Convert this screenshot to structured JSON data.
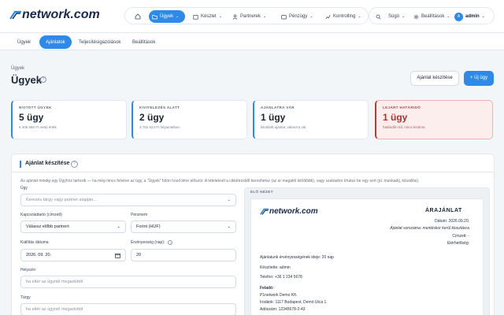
{
  "brand": {
    "logo": "network.com"
  },
  "nav": {
    "home_icon": "home-icon",
    "items": [
      {
        "label": "Ügyek"
      },
      {
        "label": "Készlet"
      },
      {
        "label": "Partnerek"
      },
      {
        "label": "Pénzügy"
      },
      {
        "label": "Kontrolling"
      }
    ],
    "search_icon": "search-icon",
    "help": "Súgó",
    "settings": "Beállítások",
    "avatar": "A",
    "user": "admin"
  },
  "subtabs": [
    {
      "label": "Ügyek"
    },
    {
      "label": "Ajánlatok"
    },
    {
      "label": "Teljesítésigazolások"
    },
    {
      "label": "Beállítások"
    }
  ],
  "page": {
    "breadcrumb": "Ügyek",
    "title": "Ügyek",
    "help": "?",
    "btn_quote": "Ajánlat készítése",
    "btn_new": "+ Új ügy"
  },
  "cards": [
    {
      "label": "NYITOTT ÜGYEK",
      "value": "5 ügy",
      "sub": "6 406 560 Ft nettó érték"
    },
    {
      "label": "KIVITELEZÉS ALATT",
      "value": "2 ügy",
      "sub": "3 752 624 Ft folyamatban"
    },
    {
      "label": "AJÁNLATRA VÁR",
      "value": "1 ügy",
      "sub": "kiküldött ajánlat, válaszra vár"
    },
    {
      "label": "LEJÁRT HATÁRIDŐ",
      "value": "1 ügy",
      "sub": "határidőn túl, nincs lezárva"
    }
  ],
  "form": {
    "title": "Ajánlat készítése",
    "help": "?",
    "intro": "Az ajánlat mindig egy Ügyhöz tartozik — ha még nincs felvéve az ügy, a \"Ügyek\" fülön hozd létre először. A tételeknél a cikktörzsből kereshetsz (az ár magától kitöltődik), vagy szabadon írhatsz be egy sort (pl. munkadíj, kiszállás).",
    "case_label": "Ügy",
    "case_placeholder": "Keresés tárgy vagy partner alapján...",
    "contact_label": "Kapcsolattartó (címzett)",
    "contact_value": "Válassz előbb partnert",
    "currency_label": "Pénznem",
    "currency_value": "Forint (HUF)",
    "issue_label": "Kiállítás dátuma",
    "issue_value": "2026. 09. 20.",
    "validity_label": "Érvényesség (nap):",
    "validity_value": "20",
    "place_label": "Helyszín",
    "place_placeholder": "ha eltér az ügynél megadottól",
    "subject_label": "Tárgy",
    "subject_placeholder": "ha eltér az ügynél megadottól"
  },
  "preview": {
    "label": "ELŐ NÉZET",
    "logo": "network.com",
    "doc_title": "ÁRAJÁNLAT",
    "date": "Dátum: 2026.09.20.",
    "number": "Ajánlat sorszáma: mentéskor kerül kiosztásra",
    "addressee": "Címzett: -",
    "contact": "Elérhetőség:",
    "validity": "Ajánlatunk érvényességének ideje: 20 nap",
    "author": "Készítette: admin",
    "phone": "Telefon: +36 1 234 5678",
    "sender_label": "Feladó:",
    "sender_name": "P1network Demo Kft.",
    "sender_addr": "Irodánk: 1117 Budapest, Demó Utca 1.",
    "sender_tax": "Adószám: 12345678-2-43"
  },
  "colors": {
    "accent": "#2e8ae6",
    "danger": "#c0392b"
  }
}
